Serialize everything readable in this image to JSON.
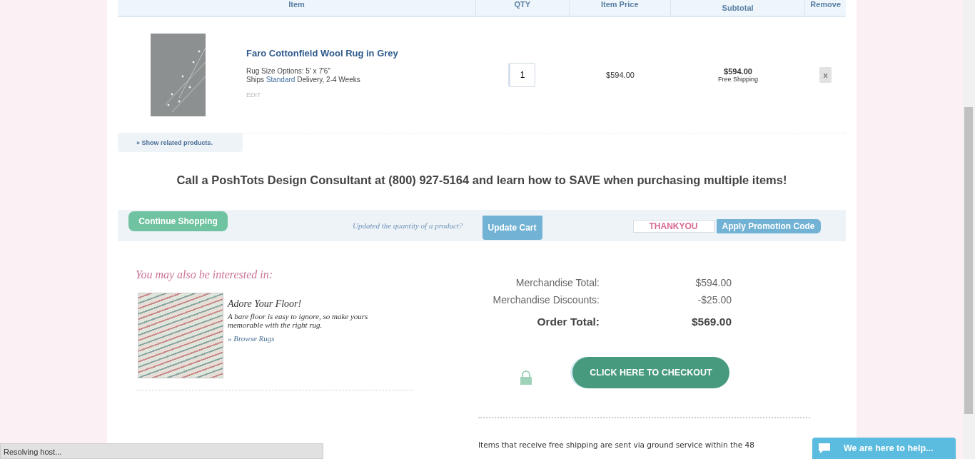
{
  "cart": {
    "columns": [
      "Item",
      "QTY",
      "Item Price",
      "Subtotal",
      "Remove"
    ],
    "items": [
      {
        "name": "Faro Cottonfield Wool Rug in Grey",
        "size": "Rug Size Options: 5' x 7'6\"",
        "ships_prefix": "Ships",
        "ships_method": "Standard",
        "ships_suffix": "Delivery, 2-4 Weeks",
        "edit": "EDIT",
        "qty": "1",
        "price": "$594.00",
        "subtotal": "$594.00",
        "shipping_note": "Free Shipping",
        "remove": "x"
      }
    ],
    "related_link": "» Show related products."
  },
  "consultant_banner": "Call a PoshTots Design Consultant at (800) 927-5164 and learn how to SAVE when purchasing multiple items!",
  "actions": {
    "continue": "Continue Shopping",
    "update_hint": "Updated the quantity of a product?",
    "update": "Update Cart",
    "promo_code": "THANKYOU",
    "apply": "Apply Promotion Code"
  },
  "suggestions": {
    "heading": "You may also be interested in:",
    "items": [
      {
        "title": "Adore Your Floor!",
        "text": "A bare floor is easy to ignore, so make yours memorable with the right rug.",
        "link": "» Browse Rugs"
      }
    ]
  },
  "totals": [
    {
      "label": "Merchandise Total:",
      "value": "$594.00",
      "kind": "normal"
    },
    {
      "label": "Merchandise Discounts:",
      "value": "-$25.00",
      "kind": "normal"
    },
    {
      "label": "Order Total:",
      "value": "$569.00",
      "kind": "grand"
    }
  ],
  "checkout": "CLICK HERE TO CHECKOUT",
  "shipping_note": "Items that receive free shipping are sent via ground service within the 48",
  "status_bar": "Resolving host...",
  "chat": "We are here to help..."
}
